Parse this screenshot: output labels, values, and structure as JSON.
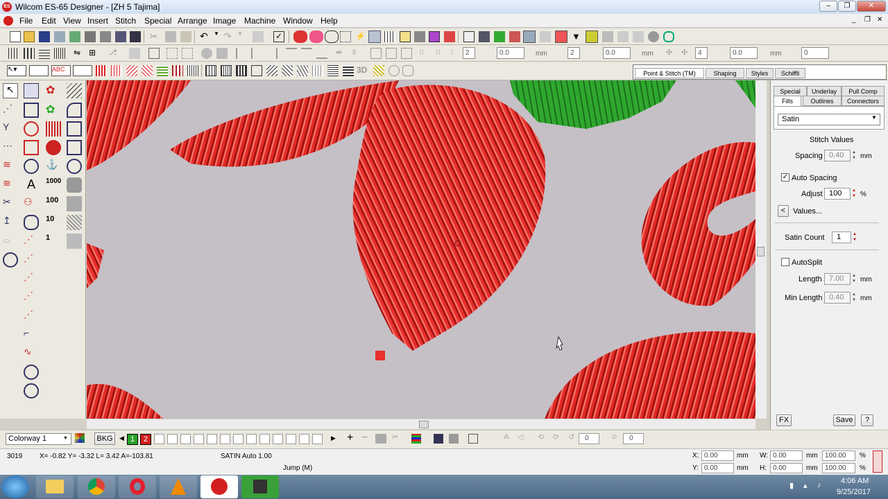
{
  "window": {
    "title": "Wilcom ES-65 Designer - [ZH 5       Tajima]",
    "logo_text": "ES",
    "minimize": "–",
    "maximize": "❐",
    "close": "✕"
  },
  "doc_controls": {
    "minimize": "_",
    "restore": "❐",
    "close": "✕"
  },
  "menu": [
    "File",
    "Edit",
    "View",
    "Insert",
    "Stitch",
    "Special",
    "Arrange",
    "Image",
    "Machine",
    "Window",
    "Help"
  ],
  "toolbar2": {
    "field1": "2",
    "field2": "0.0",
    "unit_a": "mm",
    "field3": "2",
    "field4": "0.0",
    "unit_b": "mm",
    "field5": "4",
    "field6": "0.0",
    "unit_c": "mm",
    "field7": "0"
  },
  "toolbar3_tabs": [
    "Point & Stitch (TM)",
    "Shaping",
    "Styles",
    "Schiffli"
  ],
  "panel": {
    "tabs_top": [
      "Special",
      "Underlay",
      "Pull Comp"
    ],
    "tabs_bottom": [
      "Fills",
      "Outlines",
      "Connectors"
    ],
    "fill_type": "Satin",
    "section_title": "Stitch Values",
    "spacing_label": "Spacing",
    "spacing_value": "0.40",
    "spacing_unit": "mm",
    "auto_spacing_label": "Auto Spacing",
    "auto_spacing_checked": "✓",
    "adjust_label": "Adjust",
    "adjust_value": "100",
    "adjust_unit": "%",
    "values_button": "Values...",
    "values_arrow": "<",
    "satin_count_label": "Satin Count",
    "satin_count_value": "1",
    "autosplit_label": "AutoSplit",
    "length_label": "Length",
    "length_value": "7.00",
    "length_unit": "mm",
    "min_length_label": "Min Length",
    "min_length_value": "0.40",
    "min_length_unit": "mm",
    "fx_button": "FX",
    "save_button": "Save",
    "help_button": "?"
  },
  "colorbar": {
    "colorway": "Colorway 1",
    "bkg": "BKG",
    "color1": "1",
    "color2": "2",
    "field_a": "0",
    "field_b": "0"
  },
  "status": {
    "stitch_count": "3019",
    "coords": "X= -0.82 Y= -3.32 L=   3.42 A=-103.81",
    "stitch_type": "SATIN Auto  1.00",
    "jump": "Jump (M)",
    "x_label": "X:",
    "x_value": "0.00",
    "y_label": "Y:",
    "y_value": "0.00",
    "w_label": "W:",
    "w_value": "0.00",
    "h_label": "H:",
    "h_value": "0.00",
    "mm": "mm",
    "pct1": "100.00",
    "pct2": "100.00",
    "pct_sign": "%"
  },
  "tray": {
    "time": "4:06 AM",
    "date": "9/25/2017"
  },
  "colors": {
    "stitch_red": "#e8302e",
    "stitch_green": "#2fa82f",
    "canvas": "#c5c0c6"
  }
}
